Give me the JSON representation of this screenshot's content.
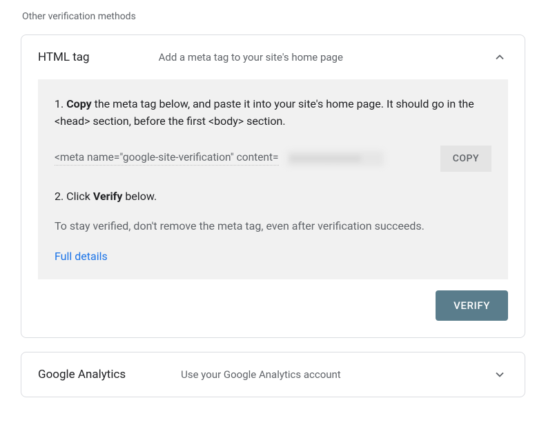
{
  "section_label": "Other verification methods",
  "htmltag": {
    "title": "HTML tag",
    "desc": "Add a meta tag to your site's home page",
    "step1_prefix": "1. ",
    "step1_bold": "Copy",
    "step1_rest_a": " the meta tag below, and paste it into your site's home page. It should go in the ",
    "step1_code_a": "<head>",
    "step1_rest_b": " section, before the first ",
    "step1_code_b": "<body>",
    "step1_rest_c": " section.",
    "meta_snippet": "<meta name=\"google-site-verification\" content=",
    "copy_btn": "COPY",
    "step2_prefix": "2. Click ",
    "step2_bold": "Verify",
    "step2_rest": " below.",
    "note": "To stay verified, don't remove the meta tag, even after verification succeeds.",
    "full_details": "Full details",
    "verify_btn": "VERIFY"
  },
  "ga": {
    "title": "Google Analytics",
    "desc": "Use your Google Analytics account"
  }
}
